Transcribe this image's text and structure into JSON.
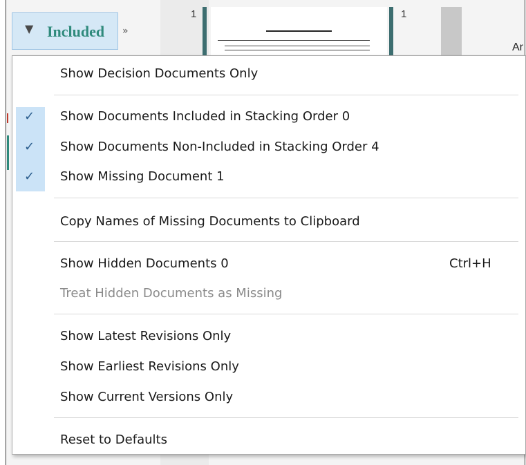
{
  "toolbar": {
    "filter_icon": "filter-icon",
    "filter_label": "Included",
    "more_chevron": "»",
    "column_counts": [
      "1",
      "1"
    ],
    "edge_text": "Ar"
  },
  "menu": {
    "items": [
      {
        "label": "Show Decision Documents Only",
        "checked": false,
        "disabled": false
      },
      {
        "label": "Show Documents Included in Stacking Order  0",
        "checked": true,
        "disabled": false
      },
      {
        "label": "Show Documents Non-Included in Stacking Order  4",
        "checked": true,
        "disabled": false
      },
      {
        "label": "Show Missing Document  1",
        "checked": true,
        "disabled": false
      },
      {
        "label": "Copy Names of Missing Documents to Clipboard",
        "checked": false,
        "disabled": false
      },
      {
        "label": "Show Hidden Documents  0",
        "shortcut": "Ctrl+H",
        "checked": false,
        "disabled": false
      },
      {
        "label": "Treat Hidden Documents as Missing",
        "checked": false,
        "disabled": true
      },
      {
        "label": "Show Latest Revisions Only",
        "checked": false,
        "disabled": false
      },
      {
        "label": "Show Earliest Revisions Only",
        "checked": false,
        "disabled": false
      },
      {
        "label": "Show Current Versions Only",
        "checked": false,
        "disabled": false
      },
      {
        "label": "Reset to Defaults",
        "checked": false,
        "disabled": false
      }
    ],
    "check_glyph": "✓"
  },
  "colors": {
    "accent": "#2f8a7c",
    "check_highlight": "#cbe3f7",
    "disabled_text": "#8a8a8a"
  }
}
